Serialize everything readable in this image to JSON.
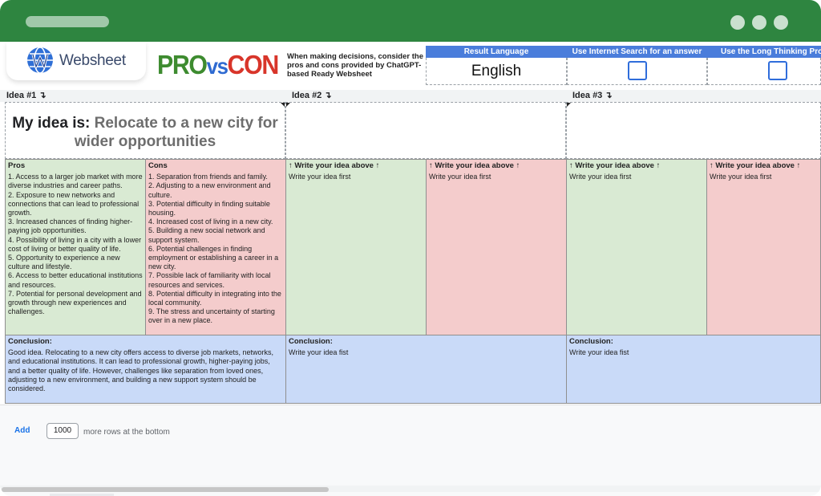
{
  "header": {
    "logo_text": "Websheet",
    "brand": {
      "pro": "PRO",
      "vs": "vs",
      "con": "CON"
    },
    "tagline": "When making decisions, consider the pros and cons provided by ChatGPT-based Ready Websheet",
    "options": {
      "result_language_label": "Result Language",
      "result_language_value": "English",
      "internet_search_label": "Use Internet Search for an answer",
      "internet_search_checked": false,
      "long_thinking_label": "Use the Long Thinking Proc",
      "long_thinking_checked": false
    }
  },
  "ideas": [
    {
      "label": "Idea #1 ↴",
      "prefix": "My idea is: ",
      "text": "Relocate to a new city for wider opportunities",
      "pros_header": "Pros",
      "pros": "1. Access to a larger job market with more diverse industries and career paths.\n2. Exposure to new networks and connections that can lead to professional growth.\n3. Increased chances of finding higher-paying job opportunities.\n4. Possibility of living in a city with a lower cost of living or better quality of life.\n5. Opportunity to experience a new culture and lifestyle.\n6. Access to better educational institutions and resources.\n7. Potential for personal development and growth through new experiences and challenges.",
      "cons_header": "Cons",
      "cons": "1. Separation from friends and family.\n2. Adjusting to a new environment and culture.\n3. Potential difficulty in finding suitable housing.\n4. Increased cost of living in a new city.\n5. Building a new social network and support system.\n6. Potential challenges in finding employment or establishing a career in a new city.\n7. Possible lack of familiarity with local resources and services.\n8. Potential difficulty in integrating into the local community.\n9. The stress and uncertainty of starting over in a new place.",
      "conclusion_header": "Conclusion:",
      "conclusion": "Good idea. Relocating to a new city offers access to diverse job markets, networks, and educational institutions. It can lead to professional growth, higher-paying jobs, and a better quality of life. However, challenges like separation from loved ones, adjusting to a new environment, and building a new support system should be considered."
    },
    {
      "label": "Idea #2 ↴",
      "text": "",
      "pros_header": "↑ Write your idea above ↑",
      "pros": "Write your idea first",
      "cons_header": "↑ Write your idea above ↑",
      "cons": "Write your idea first",
      "conclusion_header": "Conclusion:",
      "conclusion": "Write your idea fist"
    },
    {
      "label": "Idea #3 ↴",
      "text": "",
      "pros_header": "↑ Write your idea above ↑",
      "pros": "Write your idea first",
      "cons_header": "↑ Write your idea above ↑",
      "cons": "Write your idea first",
      "conclusion_header": "Conclusion:",
      "conclusion": "Write your idea fist"
    }
  ],
  "footer": {
    "add_label": "Add",
    "rows_value": "1000",
    "rows_suffix": "more rows at the bottom"
  },
  "colors": {
    "topbar": "#2e8540",
    "pros_bg": "#d9ead3",
    "cons_bg": "#f4cccc",
    "conclusion_bg": "#c9daf8",
    "option_header": "#4a7ddb"
  }
}
